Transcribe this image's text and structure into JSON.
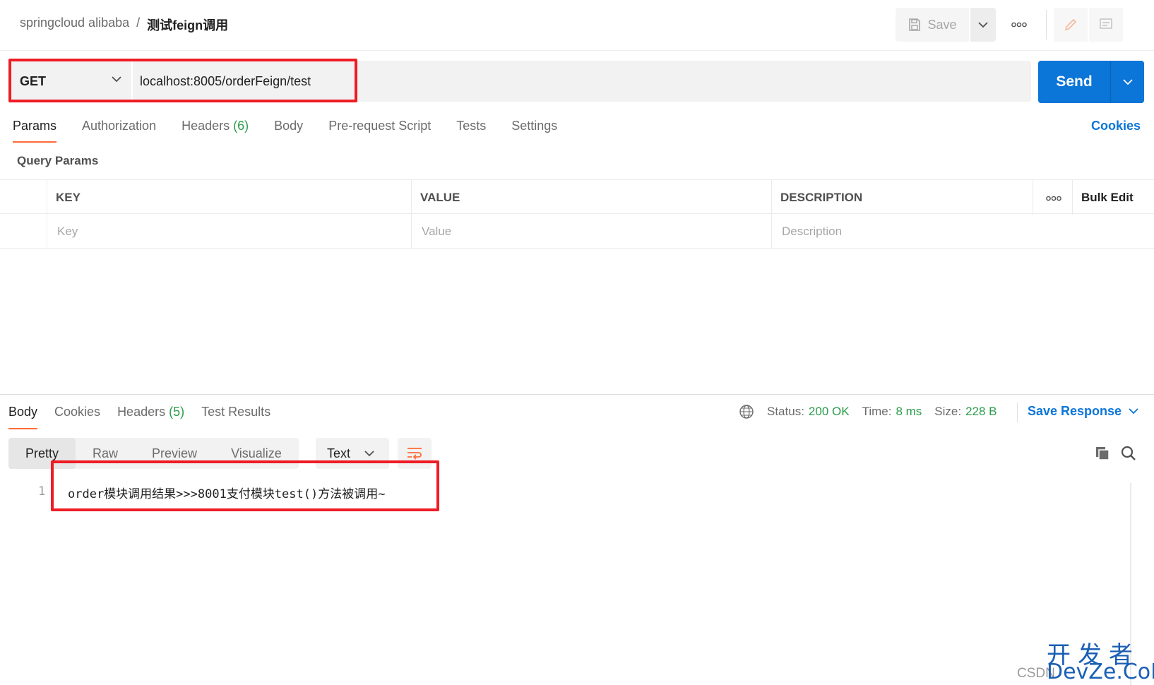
{
  "header": {
    "breadcrumb_parent": "springcloud alibaba",
    "breadcrumb_sep": "/",
    "breadcrumb_current": "测试feign调用",
    "save_label": "Save"
  },
  "request": {
    "method": "GET",
    "url": "localhost:8005/orderFeign/test",
    "send_label": "Send"
  },
  "request_tabs": [
    {
      "label": "Params",
      "count": ""
    },
    {
      "label": "Authorization",
      "count": ""
    },
    {
      "label": "Headers",
      "count": "(6)"
    },
    {
      "label": "Body",
      "count": ""
    },
    {
      "label": "Pre-request Script",
      "count": ""
    },
    {
      "label": "Tests",
      "count": ""
    },
    {
      "label": "Settings",
      "count": ""
    }
  ],
  "cookies_label": "Cookies",
  "query_params": {
    "title": "Query Params",
    "columns": {
      "key": "KEY",
      "value": "VALUE",
      "description": "DESCRIPTION",
      "bulk_edit": "Bulk Edit"
    },
    "placeholders": {
      "key": "Key",
      "value": "Value",
      "description": "Description"
    }
  },
  "response": {
    "tabs": [
      {
        "label": "Body",
        "count": ""
      },
      {
        "label": "Cookies",
        "count": ""
      },
      {
        "label": "Headers",
        "count": "(5)"
      },
      {
        "label": "Test Results",
        "count": ""
      }
    ],
    "status_label": "Status:",
    "status_value": "200 OK",
    "time_label": "Time:",
    "time_value": "8 ms",
    "size_label": "Size:",
    "size_value": "228 B",
    "save_response_label": "Save Response",
    "view_modes": [
      "Pretty",
      "Raw",
      "Preview",
      "Visualize"
    ],
    "format": "Text",
    "line_number": "1",
    "body_text": "order模块调用结果>>>8001支付模块test()方法被调用~"
  },
  "watermark": {
    "csdn": "CSDN",
    "cn": "开发者",
    "en": "DevZe.CoM"
  },
  "colors": {
    "accent": "#ff6c37",
    "send_blue": "#0b75d8",
    "status_green": "#2a9d4a",
    "highlight_red": "#ee1c24"
  }
}
